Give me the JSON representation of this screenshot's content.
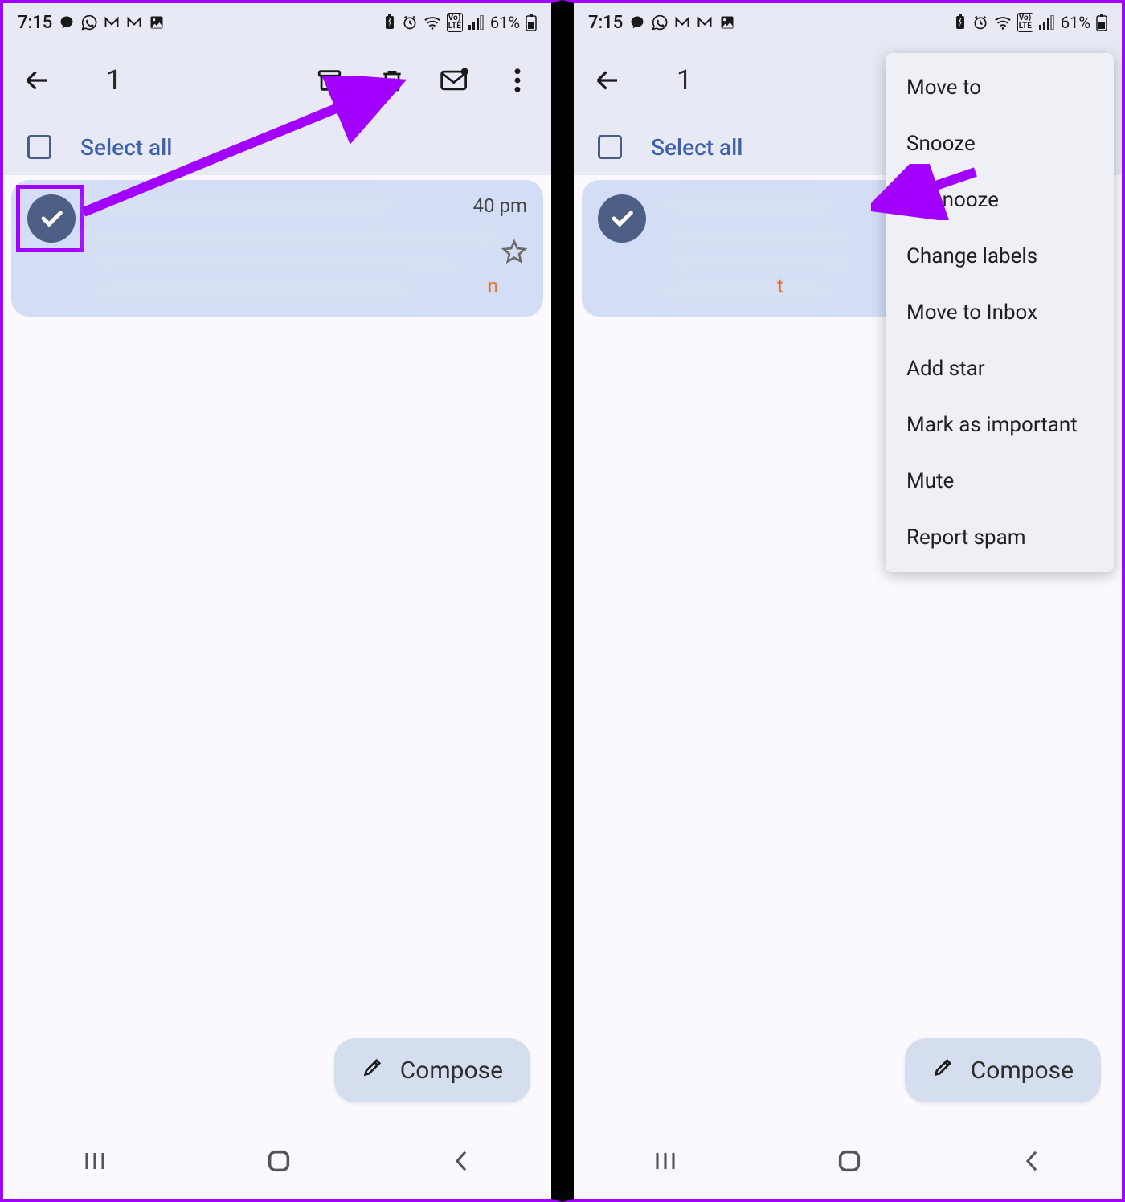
{
  "status": {
    "time": "7:15",
    "battery_text": "61%"
  },
  "actionbar": {
    "selected_count": "1"
  },
  "selectall_label": "Select all",
  "email": {
    "time": "40 pm",
    "letter_hint": "t"
  },
  "compose_label": "Compose",
  "menu": {
    "items": [
      "Move to",
      "Snooze",
      "Unsnooze",
      "Change labels",
      "Move to Inbox",
      "Add star",
      "Mark as important",
      "Mute",
      "Report spam"
    ]
  }
}
